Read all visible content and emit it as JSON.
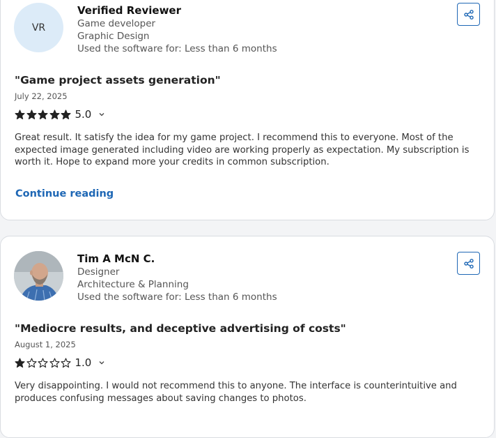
{
  "reviews": [
    {
      "avatar_initials": "VR",
      "name": "Verified Reviewer",
      "role": "Game developer",
      "industry": "Graphic Design",
      "usage": "Used the software for: Less than 6 months",
      "title": "\"Game project assets generation\"",
      "date": "July 22, 2025",
      "rating": 5,
      "rating_label": "5.0",
      "body": "Great result. It satisfy the idea for my game project. I recommend this to everyone. Most of the expected image generated including video are working properly as expectation. My subscription is worth it. Hope to expand more your credits in common subscription.",
      "continue_label": "Continue reading"
    },
    {
      "avatar_photo": "person-photo",
      "name": "Tim A McN C.",
      "role": "Designer",
      "industry": "Architecture & Planning",
      "usage": "Used the software for: Less than 6 months",
      "title": "\"Mediocre results, and deceptive advertising of costs\"",
      "date": "August 1, 2025",
      "rating": 1,
      "rating_label": "1.0",
      "body": "Very disappointing. I would not recommend this to anyone. The interface is counterintuitive and produces confusing messages about saving changes to photos."
    }
  ],
  "colors": {
    "accent": "#1e67b5",
    "avatar_bg": "#dcebf8",
    "star": "#222222"
  },
  "icons": {
    "share": "share-icon",
    "chevron": "chevron-down-icon",
    "star_full": "star-filled-icon",
    "star_empty": "star-outline-icon"
  }
}
